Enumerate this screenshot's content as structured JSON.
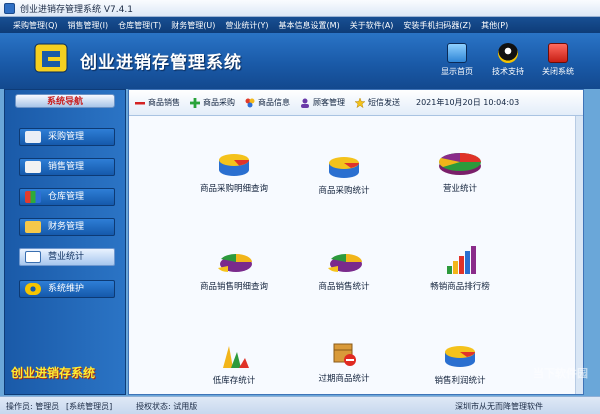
{
  "window": {
    "title": "创业进销存管理系统  V7.4.1"
  },
  "menu": [
    "采购管理(Q)",
    "销售管理(I)",
    "仓库管理(T)",
    "财务管理(U)",
    "营业统计(Y)",
    "基本信息设置(M)",
    "关于软件(A)",
    "安装手机扫码器(Z)",
    "其他(P)"
  ],
  "header": {
    "brand": "创业进销存管理系统",
    "buttons": [
      {
        "label": "显示首页",
        "icon": "monitor-icon"
      },
      {
        "label": "技术支持",
        "icon": "qq-penguin-icon"
      },
      {
        "label": "关闭系统",
        "icon": "power-icon"
      }
    ]
  },
  "sidebar": {
    "title": "系统导航",
    "items": [
      {
        "label": "采购管理",
        "icon": "truck-icon"
      },
      {
        "label": "销售管理",
        "icon": "cart-icon"
      },
      {
        "label": "仓库管理",
        "icon": "boxes-icon"
      },
      {
        "label": "财务管理",
        "icon": "finance-icon"
      },
      {
        "label": "营业统计",
        "icon": "stats-icon"
      },
      {
        "label": "系统维护",
        "icon": "gear-icon"
      }
    ],
    "active_index": 4,
    "brand": "创业进销存系统"
  },
  "toolbar": {
    "buttons": [
      {
        "label": "商品销售",
        "icon": "minus-icon"
      },
      {
        "label": "商品采购",
        "icon": "plus-icon"
      },
      {
        "label": "商品信息",
        "icon": "items-icon"
      },
      {
        "label": "顾客管理",
        "icon": "users-icon"
      },
      {
        "label": "短信发送",
        "icon": "star-icon"
      }
    ],
    "datetime": "2021年10月20日  10:04:03"
  },
  "functions": [
    {
      "label": "商品采购明细查询",
      "icon": "stack-disc-icon"
    },
    {
      "label": "商品采购统计",
      "icon": "stack-disc-icon"
    },
    {
      "label": "营业统计",
      "icon": "pie-chart-icon"
    },
    {
      "label": "商品销售明细查询",
      "icon": "pie-slice-icon"
    },
    {
      "label": "商品销售统计",
      "icon": "pie-slice-icon"
    },
    {
      "label": "畅销商品排行榜",
      "icon": "bar-rank-icon"
    },
    {
      "label": "低库存统计",
      "icon": "low-stock-icon"
    },
    {
      "label": "过期商品统计",
      "icon": "expired-box-icon"
    },
    {
      "label": "销售利润统计",
      "icon": "profit-disc-icon"
    }
  ],
  "status": {
    "operator": "操作员: 管理员",
    "role": "[系统管理员]",
    "auth": "授权状态: 试用版",
    "company": "深圳市从无而降管理软件"
  },
  "watermark": "当下软件园",
  "colors": {
    "accent": "#1a5aa8",
    "menubar": "#0e3c78",
    "brand_yellow": "#ffee33"
  }
}
